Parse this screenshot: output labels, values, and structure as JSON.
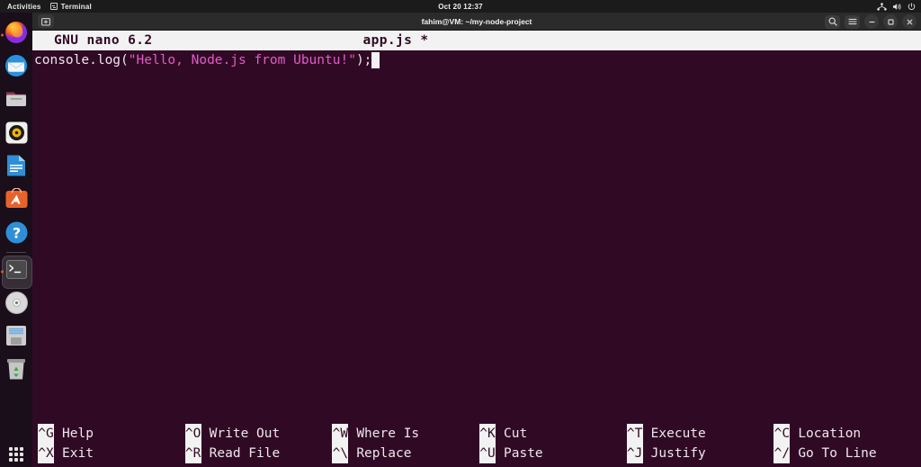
{
  "topbar": {
    "activities": "Activities",
    "app_name": "Terminal",
    "app_icon": "terminal-icon",
    "clock": "Oct 20  12:37",
    "tray_icons": [
      "network-icon",
      "volume-icon",
      "power-icon"
    ]
  },
  "dock": {
    "items": [
      {
        "name": "firefox",
        "label": "Firefox",
        "running": true,
        "active": false
      },
      {
        "name": "thunderbird",
        "label": "Thunderbird",
        "running": false,
        "active": false
      },
      {
        "name": "files",
        "label": "Files",
        "running": false,
        "active": false
      },
      {
        "name": "rhythmbox",
        "label": "Rhythmbox",
        "running": false,
        "active": false
      },
      {
        "name": "libreoffice-writer",
        "label": "LibreOffice Writer",
        "running": false,
        "active": false
      },
      {
        "name": "ubuntu-software",
        "label": "Ubuntu Software",
        "running": false,
        "active": false
      },
      {
        "name": "help",
        "label": "Help",
        "running": false,
        "active": false
      },
      {
        "name": "terminal",
        "label": "Terminal",
        "running": true,
        "active": true
      },
      {
        "name": "disc",
        "label": "Disc Image",
        "running": false,
        "active": false
      },
      {
        "name": "disks",
        "label": "Disks",
        "running": false,
        "active": false
      },
      {
        "name": "trash",
        "label": "Trash",
        "running": false,
        "active": false
      }
    ],
    "app_grid": "show-applications"
  },
  "window": {
    "title": "fahim@VM: ~/my-node-project",
    "new_tab_button": "new-tab-icon",
    "search_button": "search-icon",
    "menu_button": "hamburger-menu-icon",
    "minimize_button": "minimize-icon",
    "maximize_button": "maximize-icon",
    "close_button": "close-icon"
  },
  "nano": {
    "version": "GNU nano 6.2",
    "filename": "app.js *",
    "code": {
      "before_string": "console.log(",
      "string": "\"Hello, Node.js from Ubuntu!\"",
      "after_string": ");"
    },
    "status": "",
    "shortcuts": [
      {
        "key": "^G",
        "label": "Help",
        "key2": "^X",
        "label2": "Exit"
      },
      {
        "key": "^O",
        "label": "Write Out",
        "key2": "^R",
        "label2": "Read File"
      },
      {
        "key": "^W",
        "label": "Where Is",
        "key2": "^\\",
        "label2": "Replace"
      },
      {
        "key": "^K",
        "label": "Cut",
        "key2": "^U",
        "label2": "Paste"
      },
      {
        "key": "^T",
        "label": "Execute",
        "key2": "^J",
        "label2": "Justify"
      },
      {
        "key": "^C",
        "label": "Location",
        "key2": "^/",
        "label2": "Go To Line"
      }
    ]
  },
  "colors": {
    "terminal_bg": "#300a24",
    "nano_bar_bg": "#f2f2f2",
    "string_token": "#e45ac7",
    "accent_orange": "#e95420"
  }
}
